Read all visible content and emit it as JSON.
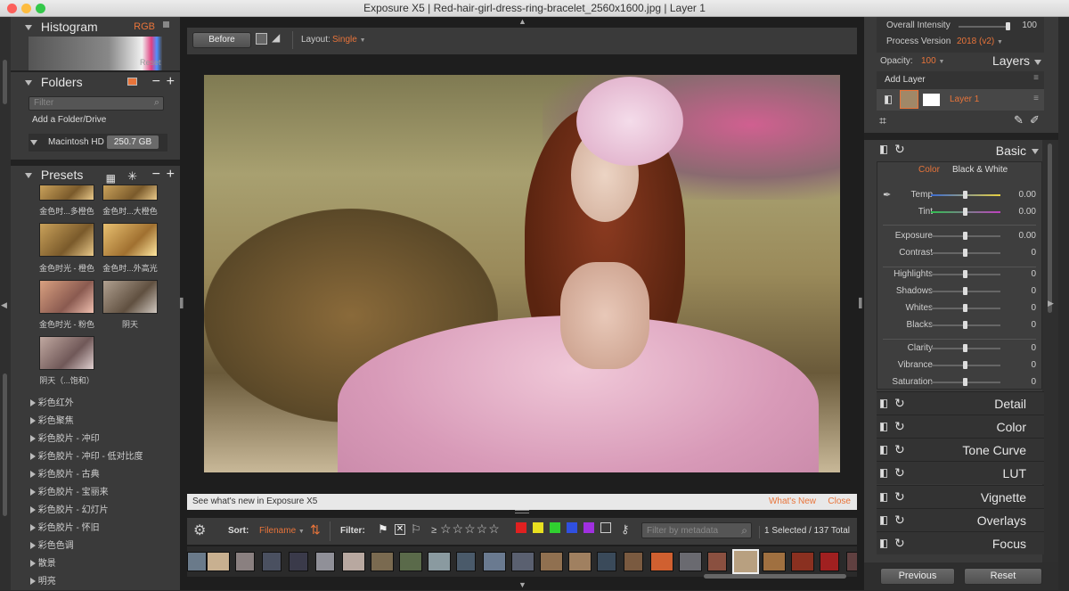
{
  "window": {
    "title": "Exposure X5 | Red-hair-girl-dress-ring-bracelet_2560x1600.jpg | Layer 1"
  },
  "histogram": {
    "title": "Histogram",
    "mode": "RGB",
    "reset": "Reset"
  },
  "folders": {
    "title": "Folders",
    "filter_placeholder": "Filter",
    "add": "Add a Folder/Drive",
    "drive": "Macintosh HD",
    "size": "250.7 GB"
  },
  "presets": {
    "title": "Presets",
    "thumbs": [
      {
        "label": "金色时...多橙色"
      },
      {
        "label": "金色时...大橙色"
      },
      {
        "label": "金色时光 - 橙色"
      },
      {
        "label": "金色时...外高光"
      },
      {
        "label": "金色时光 - 粉色"
      },
      {
        "label": "阴天"
      },
      {
        "label": "阴天（...饱和）"
      }
    ],
    "groups": [
      "彩色红外",
      "彩色聚焦",
      "彩色胶片 - 冲印",
      "彩色胶片 - 冲印 - 低对比度",
      "彩色胶片 - 古典",
      "彩色胶片 - 宝丽来",
      "彩色胶片 - 幻灯片",
      "彩色胶片 - 怀旧",
      "彩色色调",
      "散景",
      "明亮"
    ]
  },
  "toolbar": {
    "before": "Before",
    "layout_label": "Layout:",
    "layout_value": "Single"
  },
  "infobar": {
    "text": "See what's new in Exposure X5",
    "whats_new": "What's New",
    "close": "Close"
  },
  "filmbar": {
    "sort_label": "Sort:",
    "sort_value": "Filename",
    "filter_label": "Filter:",
    "ge": "≥",
    "search_placeholder": "Filter by metadata",
    "count": "1 Selected / 137 Total",
    "color_labels": [
      "#e02020",
      "#e8e020",
      "#30d030",
      "#3050e0",
      "#a030e0"
    ]
  },
  "right": {
    "overall_label": "Overall Intensity",
    "overall_value": "100",
    "overall_level": 100,
    "process_label": "Process Version",
    "process_value": "2018 (v2)",
    "opacity_label": "Opacity:",
    "opacity_value": "100",
    "layers_title": "Layers",
    "add_layer": "Add Layer",
    "layer_name": "Layer 1",
    "basic": {
      "title": "Basic",
      "tab_color": "Color",
      "tab_bw": "Black & White",
      "sliders": [
        {
          "label": "Temp",
          "value": "0.00"
        },
        {
          "label": "Tint",
          "value": "0.00"
        },
        {
          "label": "Exposure",
          "value": "0.00"
        },
        {
          "label": "Contrast",
          "value": "0"
        },
        {
          "label": "Highlights",
          "value": "0"
        },
        {
          "label": "Shadows",
          "value": "0"
        },
        {
          "label": "Whites",
          "value": "0"
        },
        {
          "label": "Blacks",
          "value": "0"
        },
        {
          "label": "Clarity",
          "value": "0"
        },
        {
          "label": "Vibrance",
          "value": "0"
        },
        {
          "label": "Saturation",
          "value": "0"
        }
      ]
    },
    "sections": [
      "Detail",
      "Color",
      "Tone Curve",
      "LUT",
      "Vignette",
      "Overlays",
      "Focus"
    ],
    "previous": "Previous",
    "reset": "Reset"
  },
  "colors": {
    "accent": "#e8743a",
    "panel": "#3a3a3a"
  }
}
